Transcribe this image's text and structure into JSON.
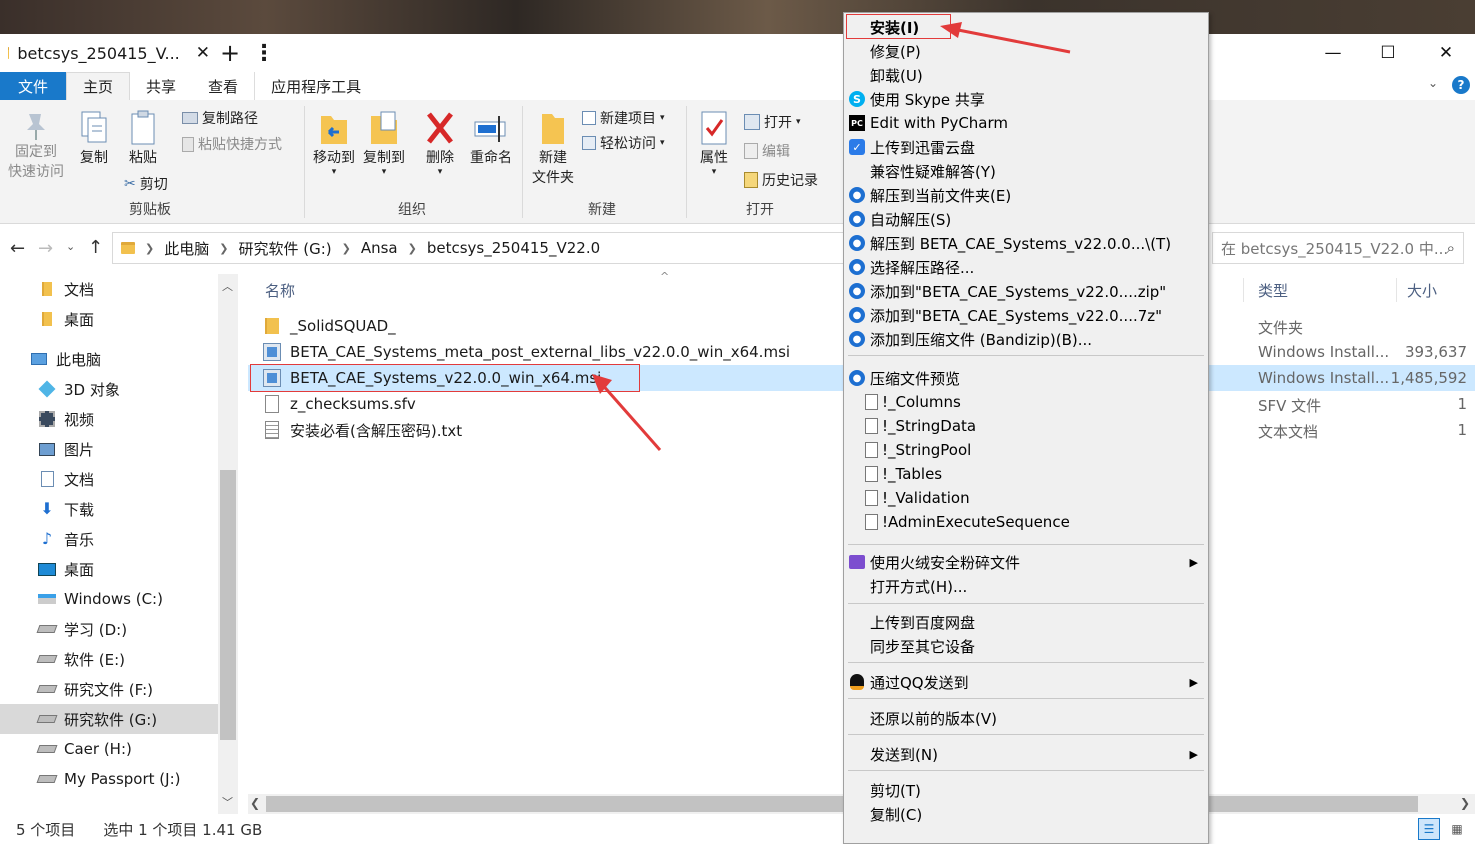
{
  "window": {
    "tab_title": "betcsys_250415_V...",
    "close_tab": "✕",
    "new_tab": "+",
    "more": "⋮",
    "minimize": "—",
    "maximize": "☐",
    "close": "✕"
  },
  "ribbon_tabs": [
    "文件",
    "主页",
    "共享",
    "查看",
    "应用程序工具"
  ],
  "ribbon": {
    "pin_label_1": "固定到",
    "pin_label_2": "快速访问",
    "copy": "复制",
    "paste": "粘贴",
    "copy_path": "复制路径",
    "paste_shortcut": "粘贴快捷方式",
    "cut": "剪切",
    "clipboard_group": "剪贴板",
    "move_to": "移动到",
    "copy_to": "复制到",
    "delete": "删除",
    "rename": "重命名",
    "organize_group": "组织",
    "new_folder_1": "新建",
    "new_folder_2": "文件夹",
    "new_item": "新建项目",
    "easy_access": "轻松访问",
    "new_group": "新建",
    "properties": "属性",
    "open": "打开",
    "edit": "编辑",
    "history": "历史记录",
    "open_group": "打开"
  },
  "address": {
    "crumbs": [
      "此电脑",
      "研究软件 (G:)",
      "Ansa",
      "betcsys_250415_V22.0"
    ],
    "search_placeholder": "在 betcsys_250415_V22.0 中..."
  },
  "nav": [
    {
      "label": "文档",
      "icon": "folder-icon",
      "indent": 1
    },
    {
      "label": "桌面",
      "icon": "folder-icon",
      "indent": 1
    },
    {
      "label": "此电脑",
      "icon": "computer-icon",
      "indent": 0
    },
    {
      "label": "3D 对象",
      "icon": "cube-icon",
      "indent": 1
    },
    {
      "label": "视频",
      "icon": "video-icon",
      "indent": 1
    },
    {
      "label": "图片",
      "icon": "picture-icon",
      "indent": 1
    },
    {
      "label": "文档",
      "icon": "document-icon",
      "indent": 1
    },
    {
      "label": "下载",
      "icon": "download-icon",
      "indent": 1
    },
    {
      "label": "音乐",
      "icon": "music-icon",
      "indent": 1
    },
    {
      "label": "桌面",
      "icon": "desktop-icon",
      "indent": 1
    },
    {
      "label": "Windows (C:)",
      "icon": "windows-drive-icon",
      "indent": 1
    },
    {
      "label": "学习 (D:)",
      "icon": "drive-icon",
      "indent": 1
    },
    {
      "label": "软件 (E:)",
      "icon": "drive-icon",
      "indent": 1
    },
    {
      "label": "研究文件 (F:)",
      "icon": "drive-icon",
      "indent": 1
    },
    {
      "label": "研究软件 (G:)",
      "icon": "drive-icon",
      "indent": 1,
      "selected": true
    },
    {
      "label": "Caer (H:)",
      "icon": "drive-icon",
      "indent": 1
    },
    {
      "label": "My Passport (J:)",
      "icon": "drive-icon",
      "indent": 1
    }
  ],
  "columns": {
    "name": "名称",
    "type": "类型",
    "size": "大小"
  },
  "files": [
    {
      "name": "_SolidSQUAD_",
      "icon": "folder-icon",
      "type": "文件夹",
      "size": ""
    },
    {
      "name": "BETA_CAE_Systems_meta_post_external_libs_v22.0.0_win_x64.msi",
      "icon": "msi-icon",
      "type": "Windows Install...",
      "size": "393,637"
    },
    {
      "name": "BETA_CAE_Systems_v22.0.0_win_x64.msi",
      "icon": "msi-icon",
      "type": "Windows Install...",
      "size": "1,485,592",
      "selected": true
    },
    {
      "name": "z_checksums.sfv",
      "icon": "file-icon",
      "type": "SFV 文件",
      "size": "1"
    },
    {
      "name": "安装必看(含解压密码).txt",
      "icon": "text-file-icon",
      "type": "文本文档",
      "size": "1"
    }
  ],
  "status": {
    "count": "5 个项目",
    "selected": "选中 1 个项目  1.41 GB"
  },
  "context_menu": [
    {
      "label": "安装(I)",
      "bold": true,
      "icon": ""
    },
    {
      "label": "修复(P)",
      "icon": ""
    },
    {
      "label": "卸载(U)",
      "icon": ""
    },
    {
      "label": "使用 Skype 共享",
      "icon": "skype-icon"
    },
    {
      "label": "Edit with PyCharm",
      "icon": "pycharm-icon"
    },
    {
      "label": "上传到迅雷云盘",
      "icon": "thunder-icon"
    },
    {
      "label": "兼容性疑难解答(Y)",
      "icon": ""
    },
    {
      "label": "解压到当前文件夹(E)",
      "icon": "bandizip-icon"
    },
    {
      "label": "自动解压(S)",
      "icon": "bandizip-icon"
    },
    {
      "label": "解压到 BETA_CAE_Systems_v22.0.0...\\(T)",
      "icon": "bandizip-icon"
    },
    {
      "label": "选择解压路径...",
      "icon": "bandizip-icon"
    },
    {
      "label": "添加到\"BETA_CAE_Systems_v22.0....zip\"",
      "icon": "bandizip-icon"
    },
    {
      "label": "添加到\"BETA_CAE_Systems_v22.0....7z\"",
      "icon": "bandizip-icon"
    },
    {
      "label": "添加到压缩文件 (Bandizip)(B)...",
      "icon": "bandizip-icon"
    },
    {
      "label": "压缩文件预览",
      "icon": "bandizip-icon"
    },
    {
      "label": "!_Columns",
      "icon": "document-icon"
    },
    {
      "label": "!_StringData",
      "icon": "document-icon"
    },
    {
      "label": "!_StringPool",
      "icon": "document-icon"
    },
    {
      "label": "!_Tables",
      "icon": "document-icon"
    },
    {
      "label": "!_Validation",
      "icon": "document-icon"
    },
    {
      "label": "!AdminExecuteSequence",
      "icon": "document-icon"
    },
    {
      "label": "使用火绒安全粉碎文件",
      "icon": "huorong-icon",
      "submenu": true
    },
    {
      "label": "打开方式(H)...",
      "icon": ""
    },
    {
      "label": "上传到百度网盘",
      "icon": ""
    },
    {
      "label": "同步至其它设备",
      "icon": ""
    },
    {
      "label": "通过QQ发送到",
      "icon": "qq-icon",
      "submenu": true
    },
    {
      "label": "还原以前的版本(V)",
      "icon": ""
    },
    {
      "label": "发送到(N)",
      "icon": "",
      "submenu": true
    },
    {
      "label": "剪切(T)",
      "icon": ""
    },
    {
      "label": "复制(C)",
      "icon": ""
    }
  ],
  "colors": {
    "accent": "#1979ca",
    "selection": "#cce8ff",
    "highlight_outline": "#e23b3b",
    "menu_bg": "#f0f0f0"
  }
}
